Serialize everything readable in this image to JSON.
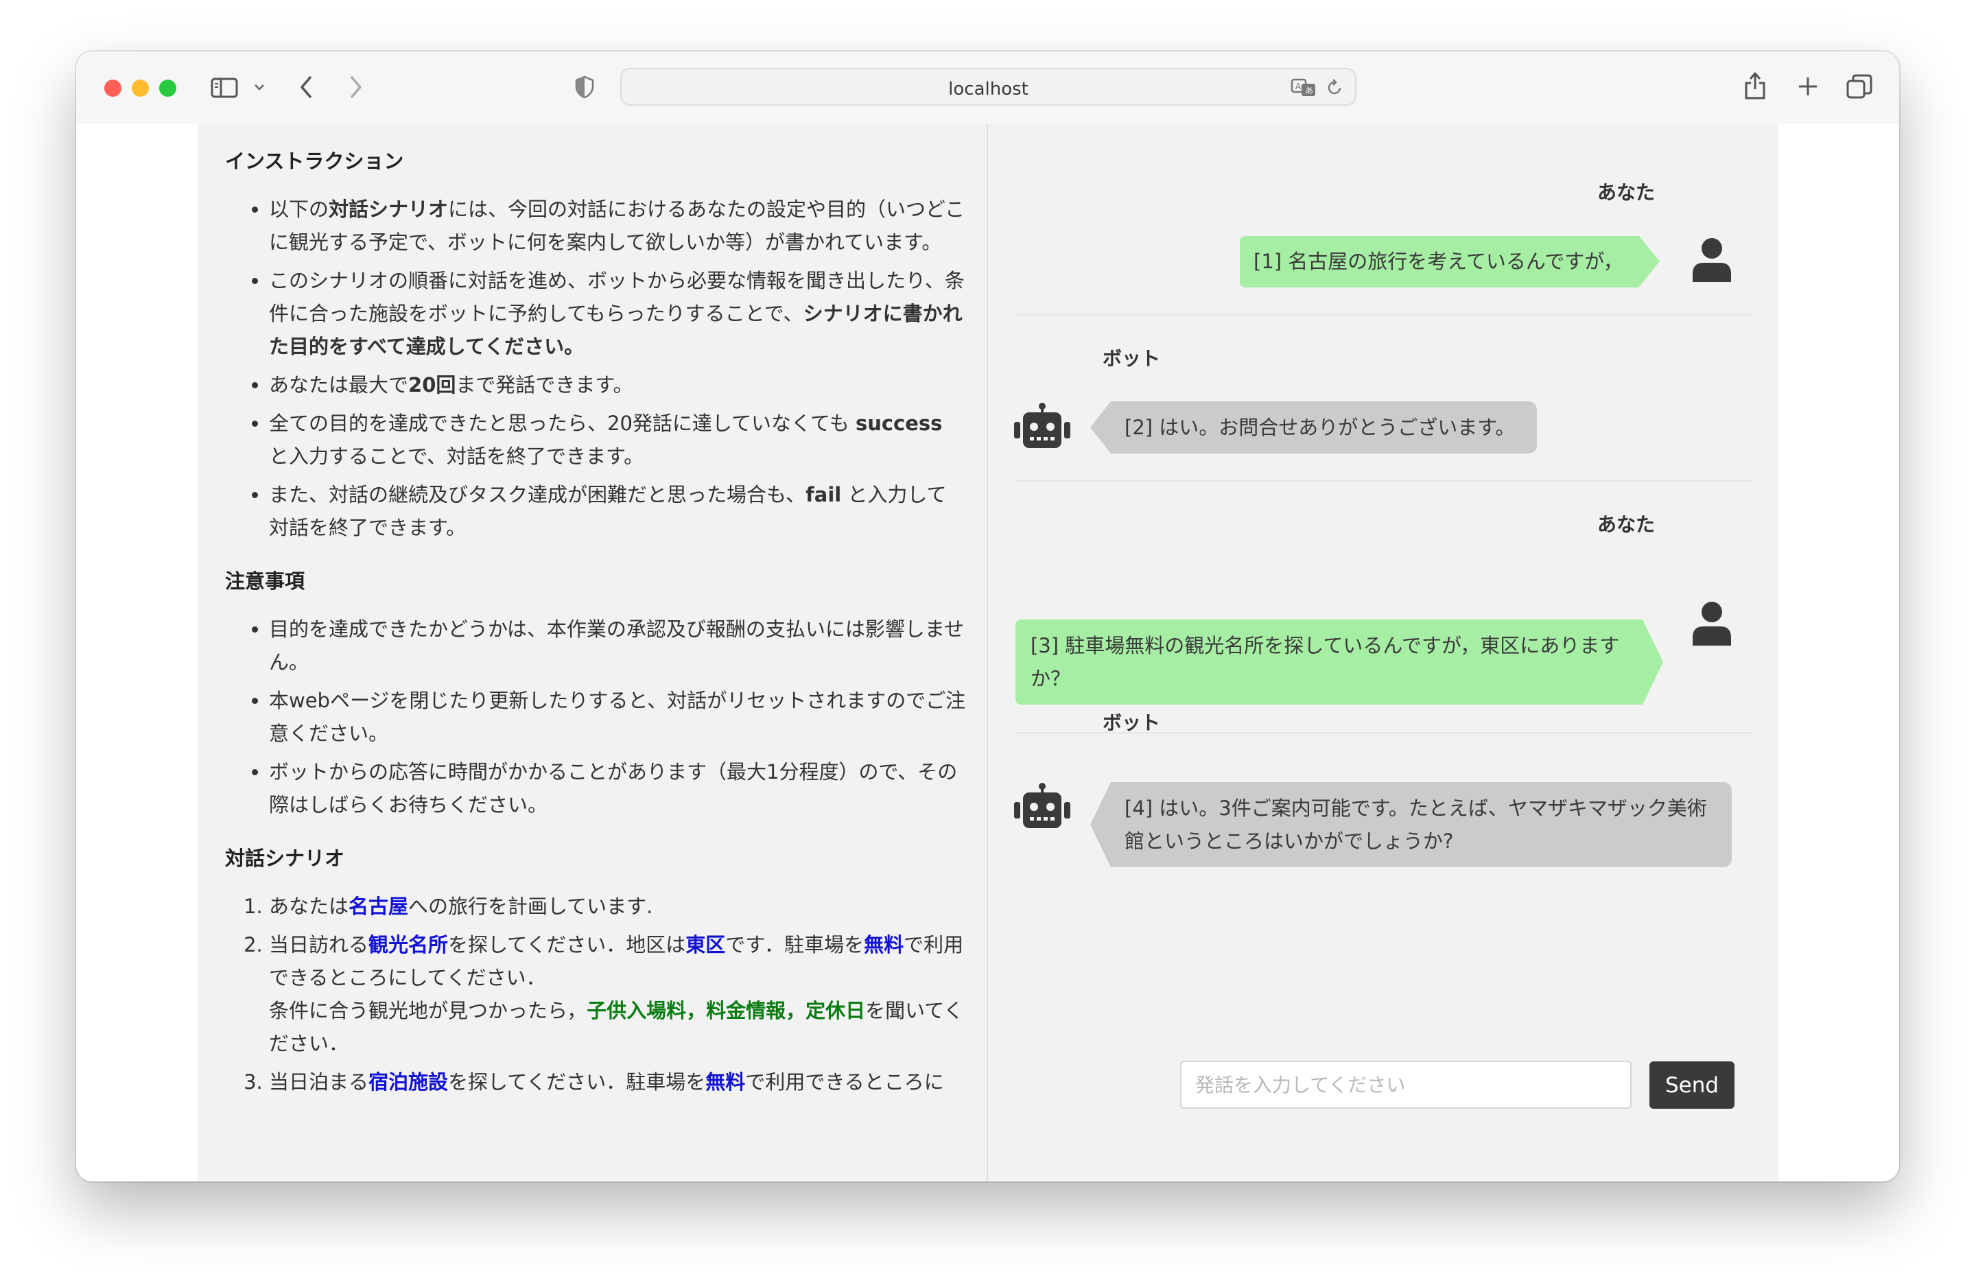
{
  "browser": {
    "url": "localhost",
    "colors": {
      "close": "#ff5f57",
      "minimize": "#febc2e",
      "zoom": "#28c840"
    },
    "icons": [
      "sidebar-icon",
      "chevron-down-icon",
      "back-icon",
      "forward-icon",
      "shield-icon",
      "translate-icon",
      "reload-icon",
      "share-icon",
      "plus-icon",
      "tabs-icon"
    ]
  },
  "instructions": {
    "heading": "インストラクション",
    "items": [
      {
        "before": "以下の",
        "bold": "対話シナリオ",
        "after": "には、今回の対話におけるあなたの設定や目的（いつどこに観光する予定で、ボットに何を案内して欲しいか等）が書かれています。"
      },
      {
        "before": "このシナリオの順番に対話を進め、ボットから必要な情報を聞き出したり、条件に合った施設をボットに予約してもらったりすることで、",
        "bold": "シナリオに書かれた目的をすべて達成してください。",
        "after": ""
      },
      {
        "before": "あなたは最大で",
        "bold": "20回",
        "after": "まで発話できます。"
      },
      {
        "before": "全ての目的を達成できたと思ったら、20発話に達していなくても ",
        "bold": "success",
        "after": " と入力することで、対話を終了できます。"
      },
      {
        "before": "また、対話の継続及びタスク達成が困難だと思った場合も、",
        "bold": "fail",
        "after": " と入力して対話を終了できます。"
      }
    ]
  },
  "notes": {
    "heading": "注意事項",
    "items": [
      "目的を達成できたかどうかは、本作業の承認及び報酬の支払いには影響しません。",
      "本webページを閉じたり更新したりすると、対話がリセットされますのでご注意ください。",
      "ボットからの応答に時間がかかることがあります（最大1分程度）ので、その際はしばらくお待ちください。"
    ]
  },
  "scenario": {
    "heading": "対話シナリオ",
    "s1": {
      "a": "あなたは",
      "b": "名古屋",
      "c": "への旅行を計画しています."
    },
    "s2": {
      "a": "当日訪れる",
      "b": "観光名所",
      "c": "を探してください．地区は",
      "d": "東区",
      "e": "です．駐車場を",
      "f": "無料",
      "g": "で利用できるところにしてください．",
      "h": "条件に合う観光地が見つかったら，",
      "i": "子供入場料，料金情報，定休日",
      "j": "を聞いてください．"
    },
    "s3": {
      "a": "当日泊まる",
      "b": "宿泊施設",
      "c": "を探してください．駐車場を",
      "d": "無料",
      "e": "で利用できるところに"
    }
  },
  "chat": {
    "messages": [
      {
        "speaker": "あなた",
        "text": "[1] 名古屋の旅行を考えているんですが，"
      },
      {
        "speaker": "ボット",
        "text": "[2] はい。お問合せありがとうございます。"
      },
      {
        "speaker": "あなた",
        "text": "[3] 駐車場無料の観光名所を探しているんですが，東区にありますか？"
      },
      {
        "speaker": "ボット",
        "text": "[4] はい。3件ご案内可能です。たとえば、ヤマザキマザック美術館というところはいかがでしょうか?"
      }
    ],
    "input_placeholder": "発話を入力してください",
    "send_label": "Send",
    "colors": {
      "user_bubble": "#a6eea4",
      "bot_bubble": "#cbcbcb",
      "send_button": "#3a3a3a"
    }
  }
}
